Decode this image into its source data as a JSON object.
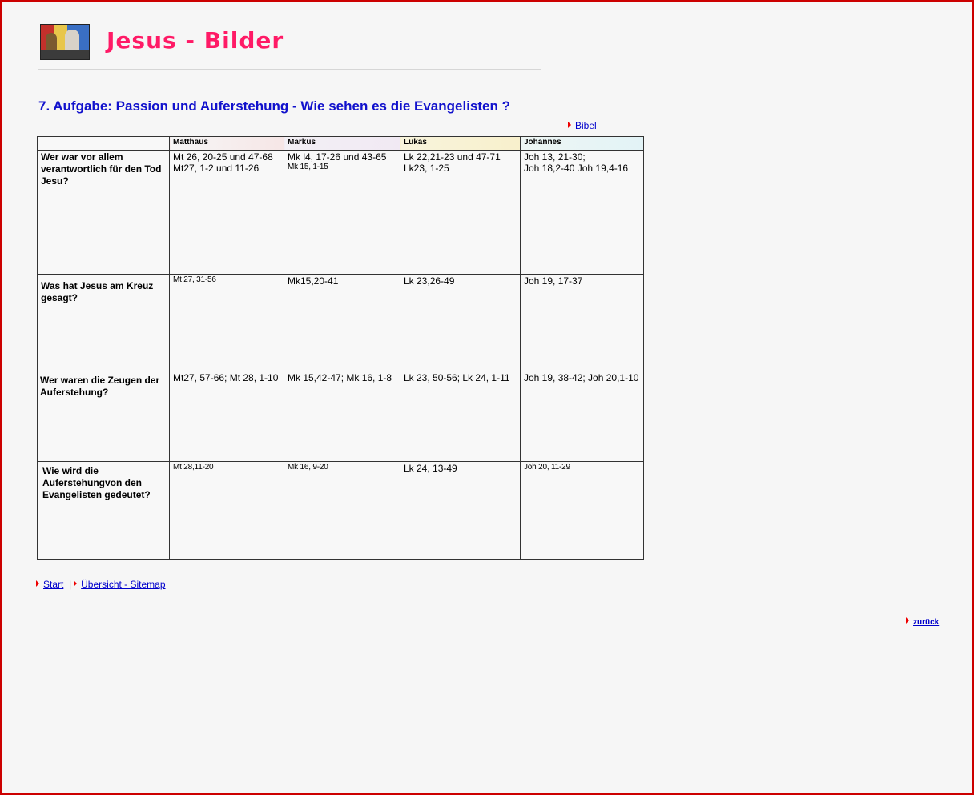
{
  "site": {
    "title": "Jesus - Bilder"
  },
  "heading": "7. Aufgabe: Passion und Auferstehung - Wie sehen es die Evangelisten ?",
  "links": {
    "bibel": "Bibel",
    "start": "Start",
    "separator": "|",
    "sitemap": "Übersicht - Sitemap",
    "back": "zurück"
  },
  "colors": {
    "title": "#ff1a66",
    "heading": "#1111cc",
    "question": "#2233cc",
    "link": "#0000cc",
    "arrow": "#e00000",
    "frame": "#cc0000"
  },
  "table": {
    "columns": [
      "",
      "Matthäus",
      "Markus",
      "Lukas",
      "Johannes"
    ],
    "rows": [
      {
        "question": "Wer war vor allem verantwortlich für den Tod Jesu?",
        "cells": [
          [
            "Mt 26, 20-25 und 47-68",
            "Mt27, 1-2 und 11-26"
          ],
          [
            "Mk l4, 17-26  und 43-65",
            "Mk 15, 1-15"
          ],
          [
            "Lk 22,21-23 und 47-71",
            "Lk23, 1-25"
          ],
          [
            "Joh 13, 21-30;",
            "Joh 18,2-40 Joh 19,4-16"
          ]
        ]
      },
      {
        "question": "Was hat Jesus am Kreuz gesagt?",
        "cells": [
          [
            "Mt 27, 31-56"
          ],
          [
            "Mk15,20-41"
          ],
          [
            "Lk 23,26-49"
          ],
          [
            "Joh 19, 17-37"
          ]
        ]
      },
      {
        "question": "Wer  waren die Zeugen der Auferstehung?",
        "cells": [
          [
            "Mt27, 57-66; Mt 28, 1-10"
          ],
          [
            "Mk 15,42-47; Mk 16, 1-8"
          ],
          [
            "Lk 23, 50-56; Lk 24, 1-11"
          ],
          [
            "Joh 19, 38-42; Joh 20,1-10"
          ]
        ]
      },
      {
        "question": "Wie wird die Auferstehungvon den Evangelisten gedeutet?",
        "cells": [
          [
            "Mt 28,11-20"
          ],
          [
            "Mk 16, 9-20"
          ],
          [
            "Lk 24, 13-49"
          ],
          [
            "Joh 20, 11-29"
          ]
        ]
      }
    ]
  }
}
